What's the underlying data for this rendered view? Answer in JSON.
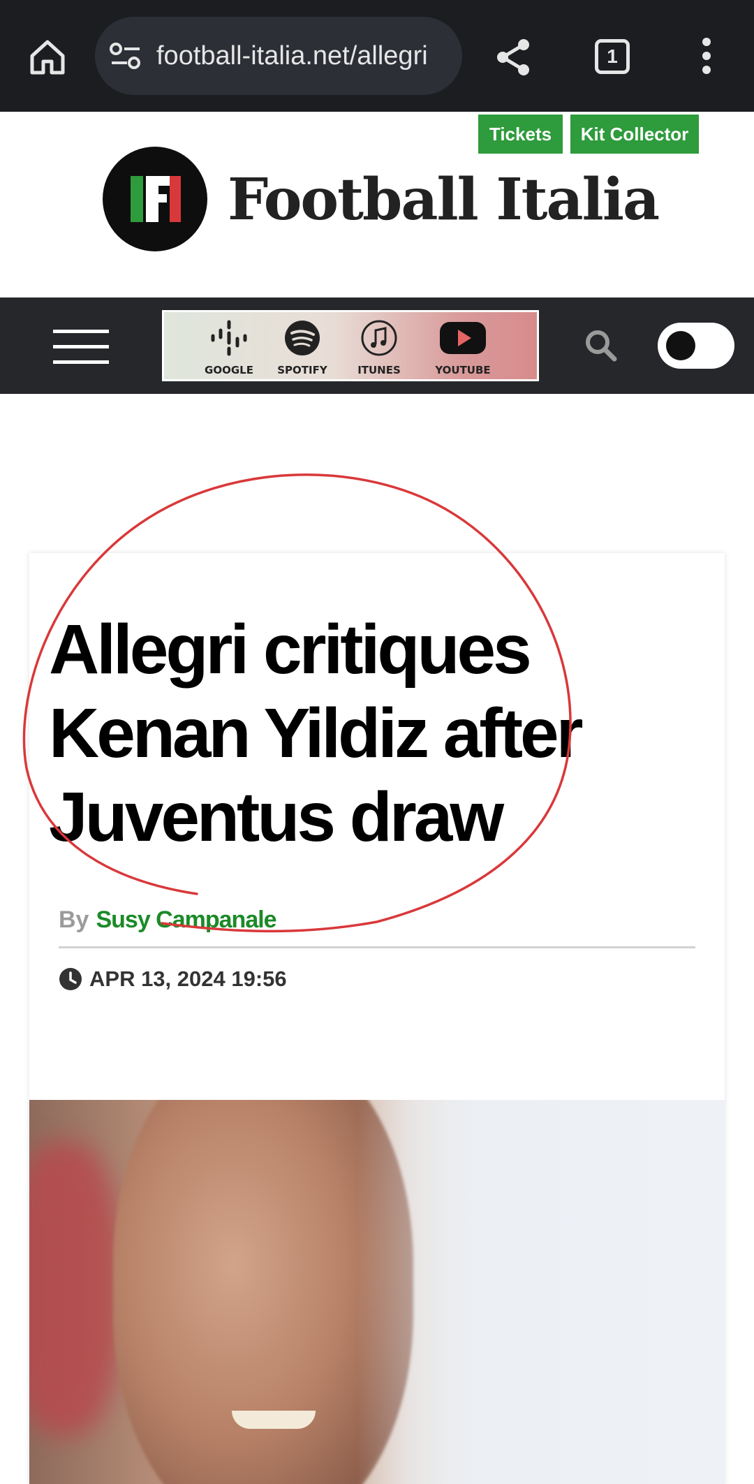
{
  "browser": {
    "url": "football-italia.net/allegri",
    "tab_count": "1"
  },
  "header": {
    "tickets_label": "Tickets",
    "kit_label": "Kit Collector",
    "logo_text": "Football Italia",
    "accent_color": "#2e9b3c"
  },
  "nav": {
    "banner_items": [
      "GOOGLE",
      "SPOTIFY",
      "ITUNES",
      "YOUTUBE"
    ]
  },
  "article": {
    "title": "Allegri critiques Kenan Yildiz after Juventus draw",
    "by_label": "By",
    "author": "Susy Campanale",
    "date": "APR 13, 2024 19:56"
  },
  "annotation_color": "#d9383a"
}
